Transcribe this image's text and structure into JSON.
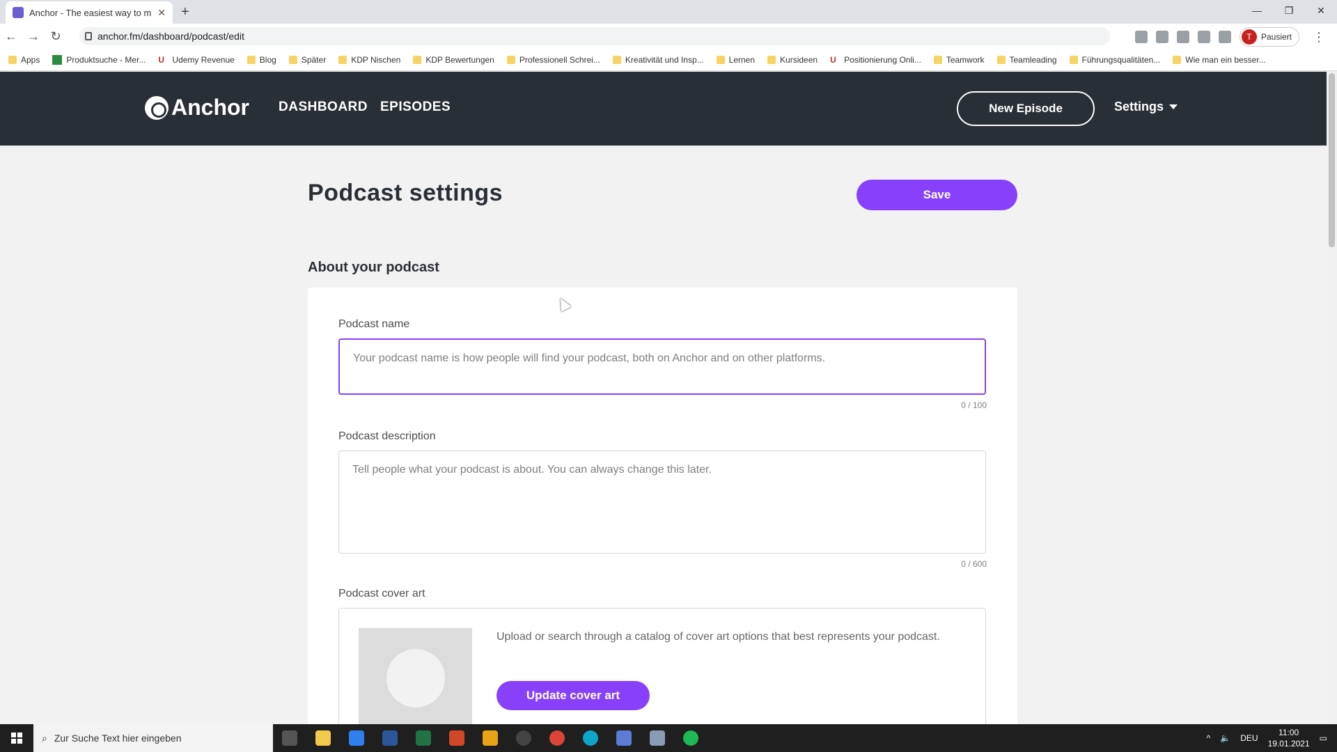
{
  "browser": {
    "tab_title": "Anchor - The easiest way to mak",
    "url": "anchor.fm/dashboard/podcast/edit",
    "profile_status": "Pausiert",
    "profile_initial": "T",
    "bookmarks": [
      "Apps",
      "Produktsuche - Mer...",
      "Udemy Revenue",
      "Blog",
      "Später",
      "KDP Nischen",
      "KDP Bewertungen",
      "Professionell Schrei...",
      "Kreativität und Insp...",
      "Lernen",
      "Kursideen",
      "Positionierung Onli...",
      "Teamwork",
      "Teamleading",
      "Führungsqualitäten...",
      "Wie man ein besser..."
    ]
  },
  "header": {
    "logo_text": "Anchor",
    "nav": [
      "DASHBOARD",
      "EPISODES"
    ],
    "new_episode_label": "New Episode",
    "settings_label": "Settings"
  },
  "page": {
    "title": "Podcast settings",
    "save_label": "Save",
    "section_title": "About your podcast",
    "name_label": "Podcast name",
    "name_placeholder": "Your podcast name is how people will find your podcast, both on Anchor and on other platforms.",
    "name_counter": "0 / 100",
    "description_label": "Podcast description",
    "description_placeholder": "Tell people what your podcast is about. You can always change this later.",
    "description_counter": "0 / 600",
    "cover_label": "Podcast cover art",
    "cover_text": "Upload or search through a catalog of cover art options that best represents your podcast.",
    "update_cover_label": "Update cover art"
  },
  "taskbar": {
    "search_placeholder": "Zur Suche Text hier eingeben",
    "language": "DEU",
    "time": "11:00",
    "date": "19.01.2021"
  },
  "colors": {
    "accent": "#8940fa",
    "header_bg": "#292f36",
    "page_bg": "#f2f2f2"
  }
}
